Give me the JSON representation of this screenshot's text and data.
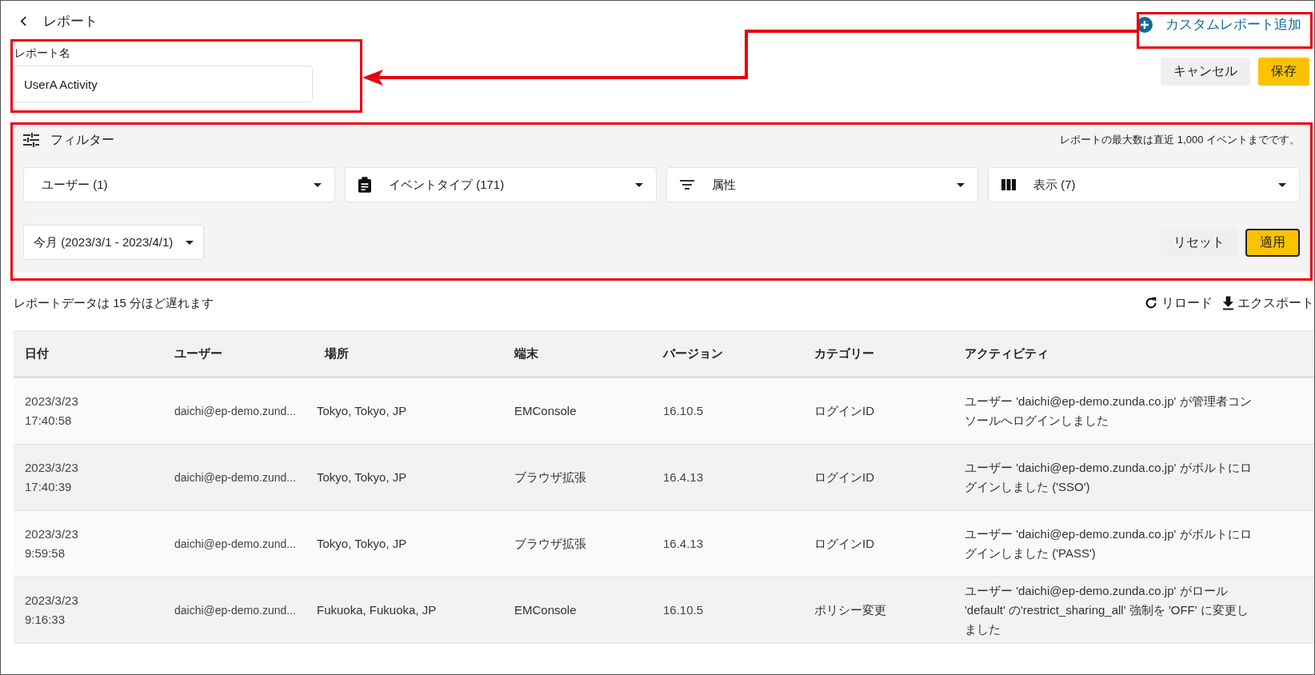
{
  "header": {
    "back_label": "レポート",
    "add_custom_report": "カスタムレポート追加"
  },
  "report_name": {
    "label": "レポート名",
    "value": "UserA Activity"
  },
  "actions": {
    "cancel": "キャンセル",
    "save": "保存"
  },
  "filter": {
    "title": "フィルター",
    "note": "レポートの最大数は直近 1,000 イベントまでです。",
    "dropdowns": [
      {
        "kind": "plain",
        "label": "ユーザー (1)"
      },
      {
        "kind": "event",
        "label": "イベントタイプ (171)"
      },
      {
        "kind": "attribute",
        "label": "属性"
      },
      {
        "kind": "columns",
        "label": "表示 (7)"
      }
    ],
    "period": "今月 (2023/3/1 - 2023/4/1)",
    "reset": "リセット",
    "apply": "適用"
  },
  "delay_note": "レポートデータは 15 分ほど遅れます",
  "reload": "リロード",
  "export": "エクスポート",
  "table": {
    "columns": [
      "日付",
      "ユーザー",
      "場所",
      "端末",
      "バージョン",
      "カテゴリー",
      "アクティビティ"
    ],
    "rows": [
      [
        "2023/3/23\n17:40:58",
        "daichi@ep-demo.zund...",
        "Tokyo, Tokyo, JP",
        "EMConsole",
        "16.10.5",
        "ログインID",
        "ユーザー 'daichi@ep-demo.zunda.co.jp' が管理者コンソールへログインしました"
      ],
      [
        "2023/3/23\n17:40:39",
        "daichi@ep-demo.zund...",
        "Tokyo, Tokyo, JP",
        "ブラウザ拡張",
        "16.4.13",
        "ログインID",
        "ユーザー 'daichi@ep-demo.zunda.co.jp' がボルトにログインしました ('SSO')"
      ],
      [
        "2023/3/23\n9:59:58",
        "daichi@ep-demo.zund...",
        "Tokyo, Tokyo, JP",
        "ブラウザ拡張",
        "16.4.13",
        "ログインID",
        "ユーザー 'daichi@ep-demo.zunda.co.jp' がボルトにログインしました ('PASS')"
      ],
      [
        "2023/3/23\n9:16:33",
        "daichi@ep-demo.zund...",
        "Fukuoka, Fukuoka, JP",
        "EMConsole",
        "16.10.5",
        "ポリシー変更",
        "ユーザー 'daichi@ep-demo.zunda.co.jp' がロール 'default' の'restrict_sharing_all' 強制を 'OFF' に変更しました"
      ]
    ]
  }
}
